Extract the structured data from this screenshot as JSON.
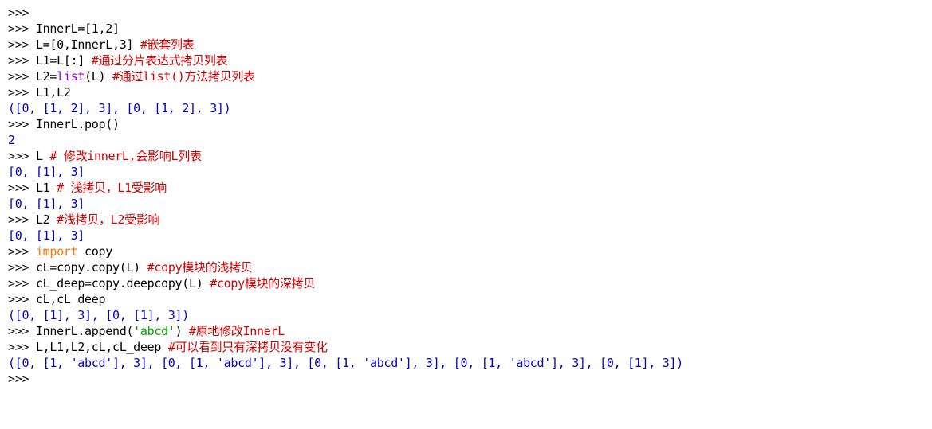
{
  "console": {
    "lines": [
      [
        {
          "t": ">>>",
          "k": "prompt"
        }
      ],
      [
        {
          "t": ">>> ",
          "k": "prompt"
        },
        {
          "t": "InnerL=[1,2]",
          "k": "code"
        }
      ],
      [
        {
          "t": ">>> ",
          "k": "prompt"
        },
        {
          "t": "L=[0,InnerL,3] ",
          "k": "code"
        },
        {
          "t": "#嵌套列表",
          "k": "comment"
        }
      ],
      [
        {
          "t": ">>> ",
          "k": "prompt"
        },
        {
          "t": "L1=L[:] ",
          "k": "code"
        },
        {
          "t": "#通过分片表达式拷贝列表",
          "k": "comment"
        }
      ],
      [
        {
          "t": ">>> ",
          "k": "prompt"
        },
        {
          "t": "L2=",
          "k": "code"
        },
        {
          "t": "list",
          "k": "builtin"
        },
        {
          "t": "(L) ",
          "k": "code"
        },
        {
          "t": "#通过list()方法拷贝列表",
          "k": "comment"
        }
      ],
      [
        {
          "t": ">>> ",
          "k": "prompt"
        },
        {
          "t": "L1,L2",
          "k": "code"
        }
      ],
      [
        {
          "t": "([0, [1, 2], 3], [0, [1, 2], 3])",
          "k": "output"
        }
      ],
      [
        {
          "t": ">>> ",
          "k": "prompt"
        },
        {
          "t": "InnerL.pop()",
          "k": "code"
        }
      ],
      [
        {
          "t": "2",
          "k": "output"
        }
      ],
      [
        {
          "t": ">>> ",
          "k": "prompt"
        },
        {
          "t": "L ",
          "k": "code"
        },
        {
          "t": "# 修改innerL,会影响L列表",
          "k": "comment"
        }
      ],
      [
        {
          "t": "[0, [1], 3]",
          "k": "output"
        }
      ],
      [
        {
          "t": ">>> ",
          "k": "prompt"
        },
        {
          "t": "L1 ",
          "k": "code"
        },
        {
          "t": "# 浅拷贝，L1受影响",
          "k": "comment"
        }
      ],
      [
        {
          "t": "[0, [1], 3]",
          "k": "output"
        }
      ],
      [
        {
          "t": ">>> ",
          "k": "prompt"
        },
        {
          "t": "L2 ",
          "k": "code"
        },
        {
          "t": "#浅拷贝，L2受影响",
          "k": "comment"
        }
      ],
      [
        {
          "t": "[0, [1], 3]",
          "k": "output"
        }
      ],
      [
        {
          "t": ">>> ",
          "k": "prompt"
        },
        {
          "t": "import",
          "k": "keyword"
        },
        {
          "t": " copy",
          "k": "code"
        }
      ],
      [
        {
          "t": ">>> ",
          "k": "prompt"
        },
        {
          "t": "cL=copy.copy(L) ",
          "k": "code"
        },
        {
          "t": "#copy模块的浅拷贝",
          "k": "comment"
        }
      ],
      [
        {
          "t": ">>> ",
          "k": "prompt"
        },
        {
          "t": "cL_deep=copy.deepcopy(L) ",
          "k": "code"
        },
        {
          "t": "#copy模块的深拷贝",
          "k": "comment"
        }
      ],
      [
        {
          "t": ">>> ",
          "k": "prompt"
        },
        {
          "t": "cL,cL_deep",
          "k": "code"
        }
      ],
      [
        {
          "t": "([0, [1], 3], [0, [1], 3])",
          "k": "output"
        }
      ],
      [
        {
          "t": ">>> ",
          "k": "prompt"
        },
        {
          "t": "InnerL.append(",
          "k": "code"
        },
        {
          "t": "'abcd'",
          "k": "string"
        },
        {
          "t": ") ",
          "k": "code"
        },
        {
          "t": "#原地修改InnerL",
          "k": "comment"
        }
      ],
      [
        {
          "t": ">>> ",
          "k": "prompt"
        },
        {
          "t": "L,L1,L2,cL,cL_deep ",
          "k": "code"
        },
        {
          "t": "#可以看到只有深拷贝没有变化",
          "k": "comment"
        }
      ],
      [
        {
          "t": "([0, [1, 'abcd'], 3], [0, [1, 'abcd'], 3], [0, [1, 'abcd'], 3], [0, [1, 'abcd'], 3], [0, [1], 3])",
          "k": "output"
        }
      ],
      [
        {
          "t": ">>>",
          "k": "prompt"
        }
      ]
    ]
  },
  "colors": {
    "prompt": "#1a1a1a",
    "code": "#000000",
    "comment": "#d40000",
    "keyword": "#ff7700",
    "builtin": "#9900cc",
    "string": "#00aa00",
    "output": "#0000c8"
  }
}
